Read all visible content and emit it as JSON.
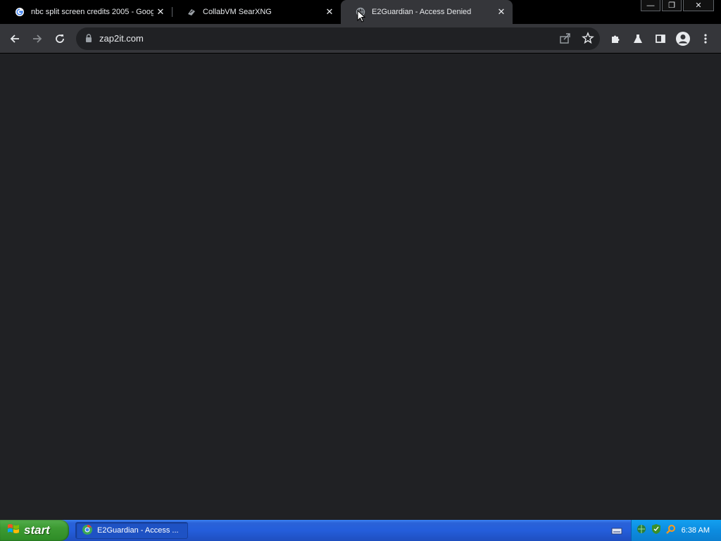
{
  "tabs": [
    {
      "title": "nbc split screen credits 2005 - Goog",
      "icon": "google-icon",
      "active": false
    },
    {
      "title": "CollabVM SearXNG",
      "icon": "searxng-icon",
      "active": false
    },
    {
      "title": "E2Guardian - Access Denied",
      "icon": "globe-icon",
      "active": true
    }
  ],
  "window_controls": {
    "minimize": "—",
    "restore": "❐",
    "close": "✕"
  },
  "address_bar": {
    "url": "zap2it.com"
  },
  "taskbar": {
    "start_label": "start",
    "task_item_label": "E2Guardian - Access ...",
    "clock": "6:38 AM"
  },
  "colors": {
    "content_bg": "#202124",
    "toolbar_bg": "#35363a",
    "tabstrip_bg": "#000000"
  }
}
